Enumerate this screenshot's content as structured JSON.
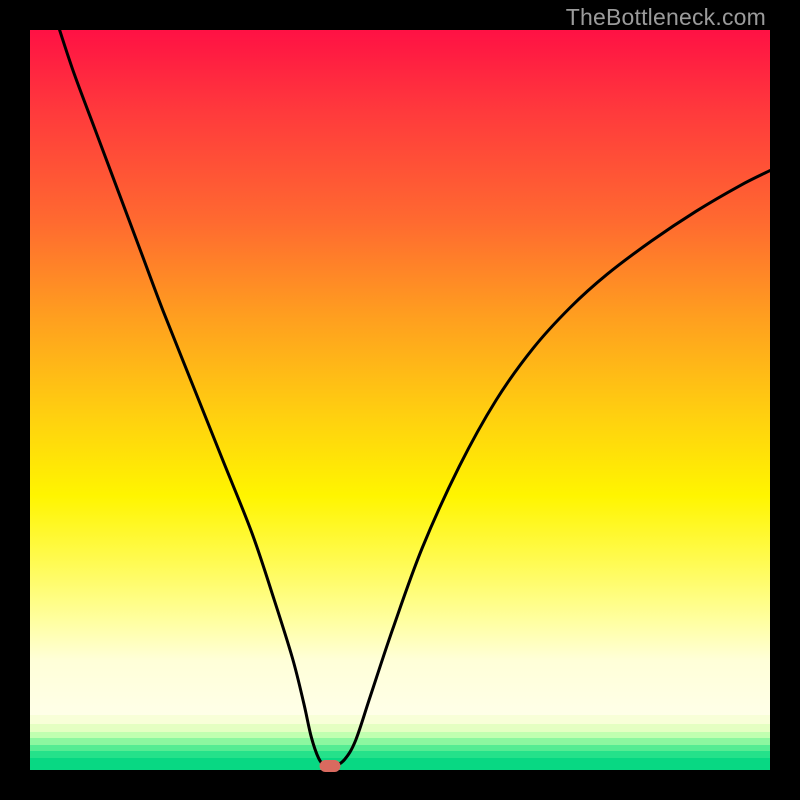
{
  "watermark": "TheBottleneck.com",
  "chart_data": {
    "type": "line",
    "title": "",
    "xlabel": "",
    "ylabel": "",
    "xlim": [
      0,
      100
    ],
    "ylim": [
      0,
      100
    ],
    "grid": false,
    "series": [
      {
        "name": "curve",
        "color": "#000000",
        "x": [
          4,
          6,
          9,
          12,
          15,
          18,
          22,
          26,
          30,
          33,
          35.5,
          37,
          38,
          39,
          40,
          41,
          42.5,
          44,
          46,
          49,
          53,
          58,
          63,
          68,
          73,
          78,
          84,
          90,
          96,
          100
        ],
        "y": [
          100,
          94,
          86,
          78,
          70,
          62,
          52,
          42,
          32,
          23,
          15,
          9,
          4.5,
          1.6,
          0.4,
          0.4,
          1.4,
          4,
          10,
          19,
          30,
          41,
          50,
          57,
          62.5,
          67,
          71.5,
          75.5,
          79,
          81
        ]
      }
    ],
    "marker": {
      "x": 40.5,
      "y": 0.5,
      "color": "#d96a5f"
    },
    "bottom_bands": [
      {
        "color": "#f8ffd8",
        "h_pct": 1.3
      },
      {
        "color": "#e4ffc2",
        "h_pct": 1.0
      },
      {
        "color": "#c0ffb0",
        "h_pct": 0.9
      },
      {
        "color": "#8cf7a0",
        "h_pct": 0.9
      },
      {
        "color": "#55ec93",
        "h_pct": 0.9
      },
      {
        "color": "#25e18a",
        "h_pct": 0.9
      },
      {
        "color": "#08d883",
        "h_pct": 1.6
      }
    ]
  }
}
